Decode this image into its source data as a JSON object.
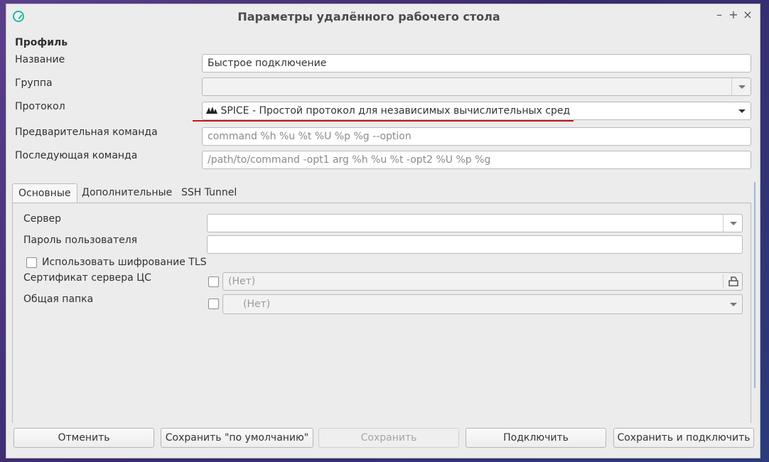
{
  "window": {
    "title": "Параметры удалённого рабочего стола",
    "controls": {
      "minimize": "–",
      "maximize": "+",
      "close": "×"
    }
  },
  "profile": {
    "section_label": "Профиль",
    "name_label": "Название",
    "name_value": "Быстрое подключение",
    "group_label": "Группа",
    "group_value": "",
    "protocol_label": "Протокол",
    "protocol_value": "SPICE - Простой протокол для независимых вычислительных сред",
    "protocol_icon": "spice-icon",
    "pre_command_label": "Предварительная команда",
    "pre_command_placeholder": "command %h %u %t %U %p %g --option",
    "post_command_label": "Последующая команда",
    "post_command_placeholder": "/path/to/command -opt1 arg %h %u %t -opt2 %U %p %g"
  },
  "tabs": [
    {
      "label": "Основные",
      "active": true
    },
    {
      "label": "Дополнительные",
      "active": false
    },
    {
      "label": "SSH Tunnel",
      "active": false
    }
  ],
  "basic": {
    "server_label": "Сервер",
    "server_value": "",
    "password_label": "Пароль пользователя",
    "password_value": "",
    "tls_label": "Использовать шифрование TLS",
    "tls_checked": false,
    "ca_cert_label": "Сертификат сервера ЦС",
    "ca_cert_checked": false,
    "ca_cert_value": "(Нет)",
    "shared_folder_label": "Общая папка",
    "shared_folder_checked": false,
    "shared_folder_value": "(Нет)"
  },
  "buttons": {
    "cancel": "Отменить",
    "save_default": "Сохранить \"по умолчанию\"",
    "save": "Сохранить",
    "connect": "Подключить",
    "save_connect": "Сохранить и подключить"
  },
  "colors": {
    "annotation_underline": "#c8141e",
    "app_accent": "#2bb3a3"
  }
}
